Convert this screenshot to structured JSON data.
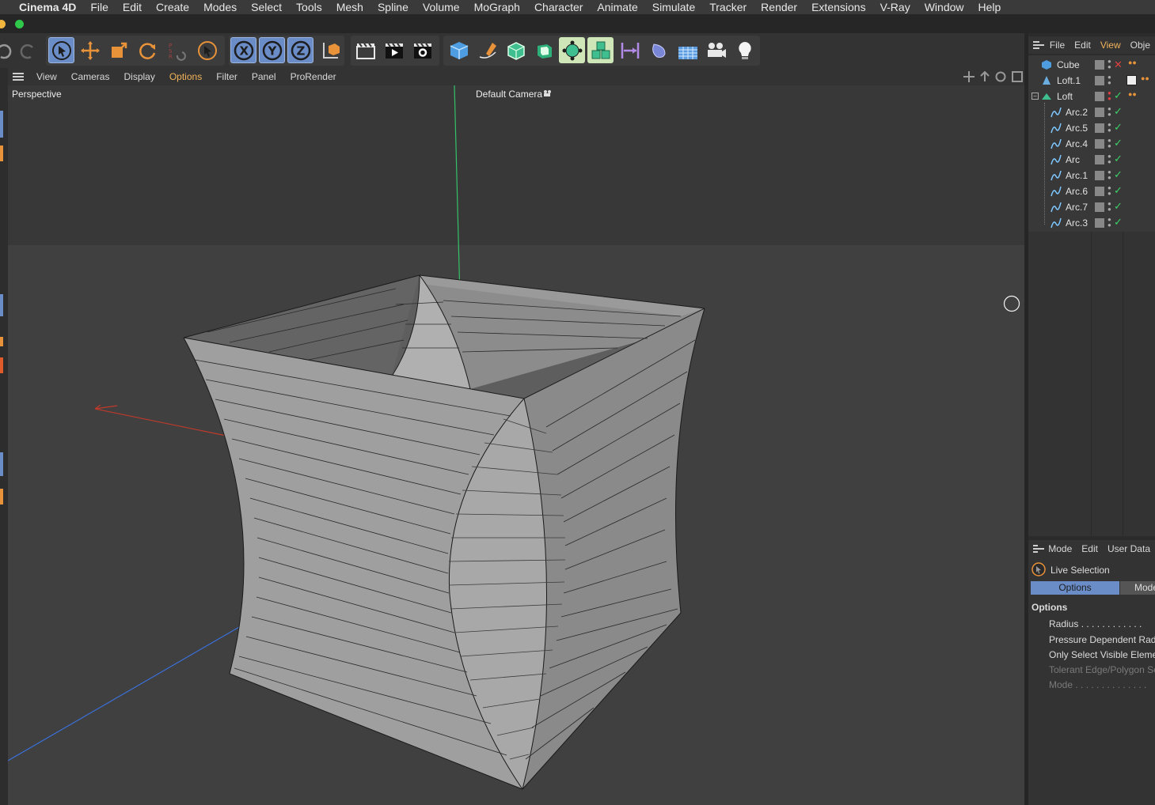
{
  "menubar": {
    "app": "Cinema 4D",
    "items": [
      "File",
      "Edit",
      "Create",
      "Modes",
      "Select",
      "Tools",
      "Mesh",
      "Spline",
      "Volume",
      "MoGraph",
      "Character",
      "Animate",
      "Simulate",
      "Tracker",
      "Render",
      "Extensions",
      "V-Ray",
      "Window",
      "Help"
    ]
  },
  "toolbar": {
    "icons": [
      "undo-icon",
      "redo-icon",
      "live-selection-icon",
      "move-icon",
      "scale-icon",
      "rotate-icon",
      "psr-icon",
      "selection-tool-icon",
      "x-axis-icon",
      "y-axis-icon",
      "z-axis-icon",
      "coordinate-system-icon",
      "render-region-icon",
      "render-view-icon",
      "render-settings-icon",
      "cube-icon",
      "pen-icon",
      "subdivision-icon",
      "extrude-icon",
      "array-icon",
      "cloner-icon",
      "bend-icon",
      "deformer-icon",
      "floor-icon",
      "camera-icon",
      "light-icon"
    ],
    "axis_labels": {
      "x": "X",
      "y": "Y",
      "z": "Z"
    }
  },
  "viewport": {
    "menu": [
      "View",
      "Cameras",
      "Display",
      "Options",
      "Filter",
      "Panel",
      "ProRender"
    ],
    "active_menu": "Options",
    "view_name": "Perspective",
    "camera_name": "Default Camera"
  },
  "object_manager": {
    "menu": [
      "File",
      "Edit",
      "View",
      "Obje"
    ],
    "active_menu": "View",
    "objects": [
      {
        "name": "Cube",
        "icon": "cube-icon",
        "status": "x"
      },
      {
        "name": "Loft.1",
        "icon": "loft-icon",
        "status": ""
      },
      {
        "name": "Loft",
        "icon": "loft-icon",
        "status": "check"
      },
      {
        "name": "Arc.2",
        "icon": "spline-icon",
        "status": "check"
      },
      {
        "name": "Arc.5",
        "icon": "spline-icon",
        "status": "check"
      },
      {
        "name": "Arc.4",
        "icon": "spline-icon",
        "status": "check"
      },
      {
        "name": "Arc",
        "icon": "spline-icon",
        "status": "check"
      },
      {
        "name": "Arc.1",
        "icon": "spline-icon",
        "status": "check"
      },
      {
        "name": "Arc.6",
        "icon": "spline-icon",
        "status": "check"
      },
      {
        "name": "Arc.7",
        "icon": "spline-icon",
        "status": "check"
      },
      {
        "name": "Arc.3",
        "icon": "spline-icon",
        "status": "check"
      }
    ]
  },
  "attribute_manager": {
    "menu": [
      "Mode",
      "Edit",
      "User Data"
    ],
    "tool_name": "Live Selection",
    "tabs": [
      "Options",
      "Mode"
    ],
    "active_tab": "Options",
    "section": "Options",
    "fields": [
      {
        "label": "Radius . . . . . . . . . . . .",
        "enabled": true
      },
      {
        "label": "Pressure Dependent Radius",
        "enabled": true
      },
      {
        "label": "Only Select Visible Elements",
        "enabled": true
      },
      {
        "label": "Tolerant Edge/Polygon Selection",
        "enabled": false
      },
      {
        "label": "Mode . . . . . . . . . . . . . .",
        "enabled": false
      }
    ]
  },
  "colors": {
    "accent": "#f0b35a",
    "selected_tool": "#6a8cc7",
    "x_axis": "#c0392b",
    "y_axis": "#2ecc71",
    "z_axis": "#3a6fd8",
    "check": "#3ecf6a",
    "cross": "#e04040"
  }
}
